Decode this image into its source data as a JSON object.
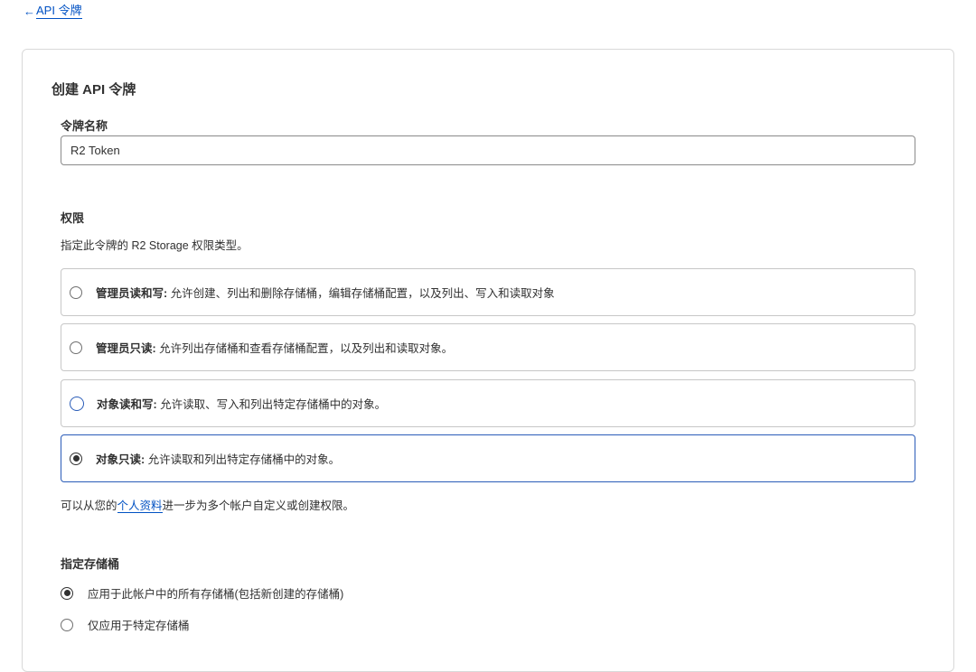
{
  "back_link": {
    "arrow": "←",
    "label": "API 令牌"
  },
  "card": {
    "title": "创建 API 令牌",
    "token_name": {
      "label": "令牌名称",
      "value": "R2 Token"
    },
    "permissions": {
      "heading": "权限",
      "description": "指定此令牌的 R2 Storage 权限类型。",
      "options": [
        {
          "title": "管理员读和写:",
          "text": " 允许创建、列出和删除存储桶，编辑存储桶配置，以及列出、写入和读取对象",
          "selected": false
        },
        {
          "title": "管理员只读:",
          "text": " 允许列出存储桶和查看存储桶配置，以及列出和读取对象。",
          "selected": false
        },
        {
          "title": "对象读和写:",
          "text": " 允许读取、写入和列出特定存储桶中的对象。",
          "selected": false
        },
        {
          "title": "对象只读:",
          "text": " 允许读取和列出特定存储桶中的对象。",
          "selected": true
        }
      ],
      "footnote_prefix": "可以从您的",
      "footnote_link": "个人资料",
      "footnote_suffix": "进一步为多个帐户自定义或创建权限。"
    },
    "buckets": {
      "heading": "指定存储桶",
      "options": [
        {
          "label": "应用于此帐户中的所有存储桶(包括新创建的存储桶)",
          "selected": true
        },
        {
          "label": "仅应用于特定存储桶",
          "selected": false
        }
      ]
    }
  }
}
